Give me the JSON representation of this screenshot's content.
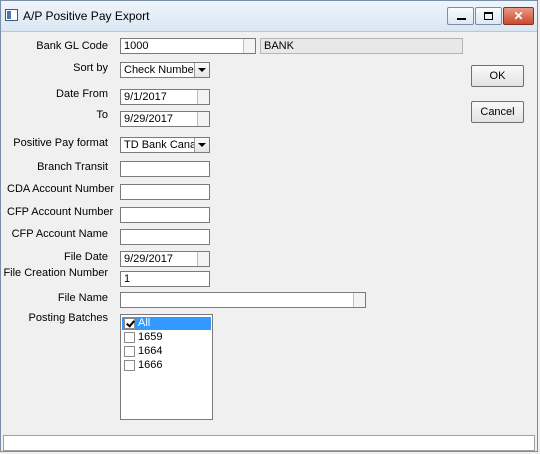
{
  "window": {
    "title": "A/P Positive Pay Export"
  },
  "caption_buttons": {
    "minimize": "—",
    "maximize": "□",
    "close": "✕"
  },
  "form": {
    "bank_gl_code": {
      "label": "Bank GL Code",
      "value": "1000",
      "description": "BANK"
    },
    "sort_by": {
      "label": "Sort by",
      "value": "Check Number"
    },
    "date_from": {
      "label": "Date From",
      "value": "9/1/2017"
    },
    "date_to": {
      "label": "To",
      "value": "9/29/2017"
    },
    "positive_pay_format": {
      "label": "Positive Pay format",
      "value": "TD Bank Canac"
    },
    "branch_transit": {
      "label": "Branch Transit",
      "value": ""
    },
    "cda_account_number": {
      "label": "CDA Account Number",
      "value": ""
    },
    "cfp_account_number": {
      "label": "CFP Account Number",
      "value": ""
    },
    "cfp_account_name": {
      "label": "CFP Account Name",
      "value": ""
    },
    "file_date": {
      "label": "File Date",
      "value": "9/29/2017"
    },
    "file_creation_number": {
      "label": "File Creation Number",
      "value": "1"
    },
    "file_name": {
      "label": "File Name",
      "value": ""
    },
    "posting_batches": {
      "label": "Posting Batches",
      "items": [
        {
          "label": "All",
          "checked": true,
          "selected": true
        },
        {
          "label": "1659",
          "checked": false,
          "selected": false
        },
        {
          "label": "1664",
          "checked": false,
          "selected": false
        },
        {
          "label": "1666",
          "checked": false,
          "selected": false
        }
      ]
    }
  },
  "buttons": {
    "ok": "OK",
    "cancel": "Cancel"
  },
  "status": {
    "text": ""
  }
}
